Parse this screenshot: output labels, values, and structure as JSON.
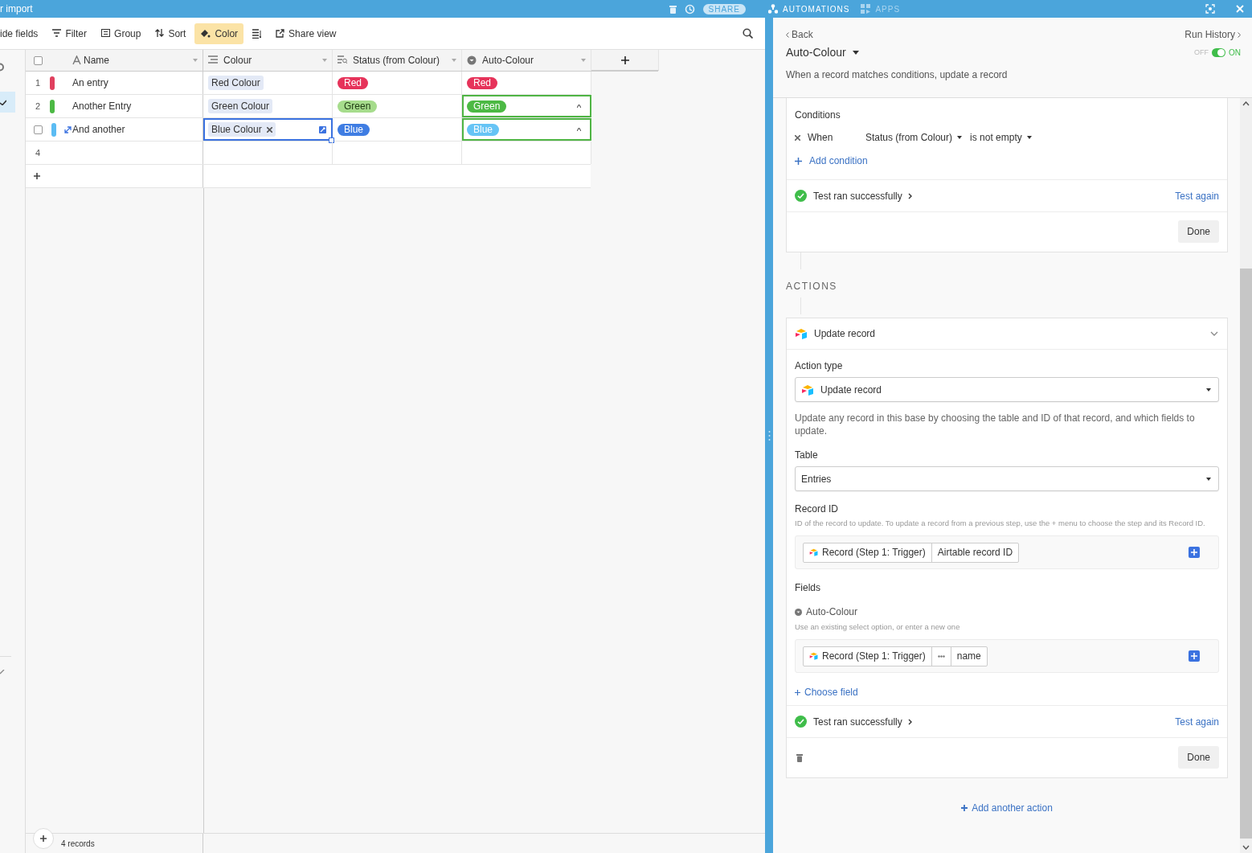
{
  "top_bar": {
    "title": "r import",
    "share": "SHARE",
    "automations": "AUTOMATIONS",
    "apps": "APPS"
  },
  "toolbar": {
    "items": [
      {
        "kind": "eye",
        "label": "ide fields",
        "selected": false
      },
      {
        "kind": "filter",
        "label": "Filter",
        "selected": false
      },
      {
        "kind": "group",
        "label": "Group",
        "selected": false
      },
      {
        "kind": "sort",
        "label": "Sort",
        "selected": false
      },
      {
        "kind": "color",
        "label": "Color",
        "selected": true
      },
      {
        "kind": "height",
        "selected": false
      },
      {
        "kind": "share",
        "label": "Share view",
        "selected": false
      }
    ]
  },
  "grid": {
    "all_checked": false,
    "columns": [
      {
        "kind": "text",
        "label": "Name"
      },
      {
        "kind": "link",
        "label": "Colour"
      },
      {
        "kind": "lookup",
        "label": "Status (from Colour)"
      },
      {
        "kind": "select",
        "label": "Auto-Colour"
      }
    ],
    "rows": [
      {
        "number": "1",
        "color": "#e0405e",
        "name": "An entry",
        "hovered": false,
        "colour": {
          "label": "Red Colour",
          "editing": false
        },
        "status": {
          "label": "Red",
          "color": "#e6335a"
        },
        "auto_colour": {
          "label": "Red",
          "color": "#e6335a",
          "selected": false
        }
      },
      {
        "number": "2",
        "color": "#4cb944",
        "name": "Another Entry",
        "hovered": false,
        "colour": {
          "label": "Green Colour",
          "editing": false
        },
        "status": {
          "label": "Green",
          "color": "#a6dc8c"
        },
        "auto_colour": {
          "label": "Green",
          "color": "#4cb944",
          "selected": true
        }
      },
      {
        "checked": false,
        "color": "#5bbcf3",
        "name": "And another",
        "hovered": true,
        "colour": {
          "label": "Blue Colour",
          "editing": true
        },
        "status": {
          "label": "Blue",
          "color": "#3f7de3"
        },
        "auto_colour": {
          "label": "Blue",
          "color": "#66c4f5",
          "selected": true
        }
      },
      {
        "number": "4"
      }
    ],
    "footer": "4 records"
  },
  "automation": {
    "back": "Back",
    "run_history": "Run History",
    "name": "Auto-Colour",
    "toggle": {
      "off_label": "OFF",
      "on_label": "ON",
      "on": true
    },
    "description": "When a record matches conditions, update a record",
    "conditions": {
      "title": "Conditions",
      "condition": {
        "prefix": "When",
        "field": "Status (from Colour)",
        "operator": "is not empty"
      },
      "add_condition": "Add condition",
      "test_status": "Test ran successfully",
      "test_again": "Test again",
      "done": "Done"
    },
    "actions_heading": "ACTIONS",
    "action": {
      "title": "Update record",
      "action_type_label": "Action type",
      "action_type": "Update record",
      "help": "Update any record in this base by choosing the table and ID of that record, and which fields to update.",
      "table_label": "Table",
      "table": "Entries",
      "record_id_label": "Record ID",
      "record_id_hint": "ID of the record to update. To update a record from a previous step, use the + menu to choose the step and its Record ID.",
      "record_id_tokens": [
        {
          "kind": "record",
          "label": "Record (Step 1: Trigger)"
        },
        {
          "kind": "field",
          "label": "Airtable record ID"
        }
      ],
      "fields_label": "Fields",
      "field_name": "Auto-Colour",
      "field_hint": "Use an existing select option, or enter a new one",
      "field_tokens": [
        {
          "kind": "record",
          "label": "Record (Step 1: Trigger)"
        },
        {
          "kind": "more"
        },
        {
          "kind": "field",
          "label": "name"
        }
      ],
      "choose_field": "Choose field",
      "test_status": "Test ran successfully",
      "test_again": "Test again",
      "done": "Done"
    },
    "add_action": "Add another action"
  }
}
